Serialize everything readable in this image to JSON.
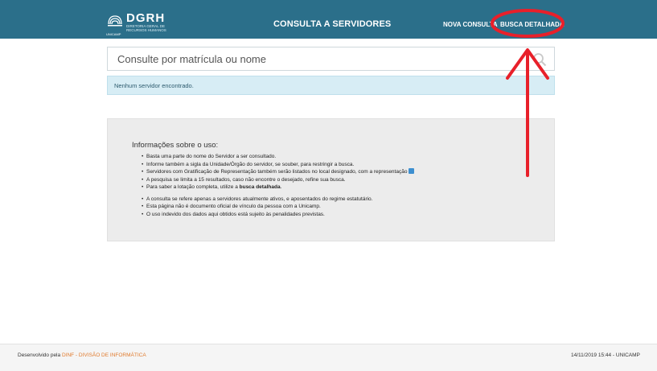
{
  "header": {
    "logo_text": "DGRH",
    "logo_subtitle": "DIRETORIA GERAL DE RECURSOS HUMANOS",
    "logo_org": "UNICAMP",
    "title": "CONSULTA A SERVIDORES",
    "nav": {
      "new_search": "NOVA CONSULTA",
      "detailed_search": "BUSCA DETALHADA"
    },
    "bar_color": "#2b6f8a"
  },
  "search": {
    "placeholder": "Consulte por matrícula ou nome",
    "value": ""
  },
  "alert": {
    "message": "Nenhum servidor encontrado.",
    "color": "#d7edf5"
  },
  "info": {
    "title": "Informações sobre o uso:",
    "items": [
      "Basta uma parte do nome do Servidor a ser consultado.",
      "Informe também a sigla da Unidade/Órgão do servidor, se souber, para restringir a busca.",
      "Servidores com Gratificação de Representação também serão listados no local designado, com a representação",
      "A pesquisa se limita a 15 resultados, caso não encontre o desejado, refine sua busca.",
      "Para saber a lotação completa, utilize a "
    ],
    "item5_bold": "busca detalhada",
    "item5_end": ".",
    "notes": [
      "A consulta se refere apenas a servidores atualmente ativos, e aposentados do regime estatutário.",
      "Esta página não é documento oficial de vínculo da pessoa com a Unicamp.",
      "O uso indevido dos dados aqui obtidos está sujeito às penalidades previstas."
    ]
  },
  "footer": {
    "developed_by": "Desenvolvido pela ",
    "link": "DINF - DIVISÃO DE INFORMÁTICA",
    "timestamp": "14/11/2019 15:44 - UNICAMP",
    "link_color": "#e07a2d"
  },
  "annotation": {
    "color": "#e8202a"
  }
}
